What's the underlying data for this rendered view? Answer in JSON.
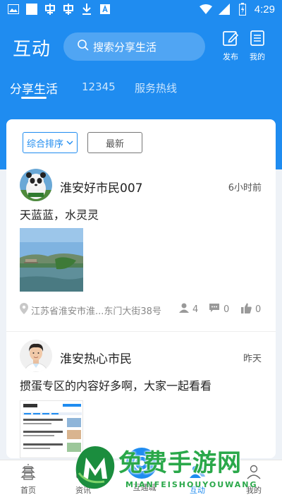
{
  "status_bar": {
    "time": "4:29",
    "left_icons": [
      "image-icon",
      "square-icon",
      "app-icon",
      "app-icon",
      "download-icon",
      "a-icon"
    ],
    "right_icons": [
      "wifi-icon",
      "signal-icon",
      "battery-charging-icon"
    ]
  },
  "header": {
    "title": "互动",
    "search_placeholder": "搜索分享生活",
    "actions": [
      {
        "label": "发布",
        "icon": "edit-icon"
      },
      {
        "label": "我的",
        "icon": "document-icon"
      }
    ]
  },
  "tabs": [
    {
      "label": "分享生活",
      "active": true
    },
    {
      "label": "12345",
      "active": false
    },
    {
      "label": "服务热线",
      "active": false
    }
  ],
  "filters": {
    "sort_label": "综合排序",
    "latest_label": "最新"
  },
  "posts": [
    {
      "username": "淮安好市民007",
      "time": "6小时前",
      "text": "天蓝蓝，水灵灵",
      "location": "江苏省淮安市淮...东门大街38号",
      "views": "4",
      "comments": "0",
      "likes": "0"
    },
    {
      "username": "淮安热心市民",
      "time": "昨天",
      "text": "掼蛋专区的内容好多啊，大家一起看看"
    }
  ],
  "bottom_nav": [
    {
      "label": "首页",
      "icon": "pagoda-icon"
    },
    {
      "label": "资讯",
      "icon": "news-icon"
    },
    {
      "label": "",
      "icon": "center-fab-icon"
    },
    {
      "label": "互通城",
      "icon": "city-icon"
    },
    {
      "label": "互动",
      "icon": "interact-icon",
      "active": true
    },
    {
      "label": "我的",
      "icon": "user-icon"
    }
  ],
  "watermark": {
    "text": "免费手游网",
    "sub": "MIANFEISHOUYOUWANG"
  },
  "colors": {
    "primary": "#1f8cf0",
    "background": "#eef2f7",
    "watermark": "#2aa84a"
  }
}
